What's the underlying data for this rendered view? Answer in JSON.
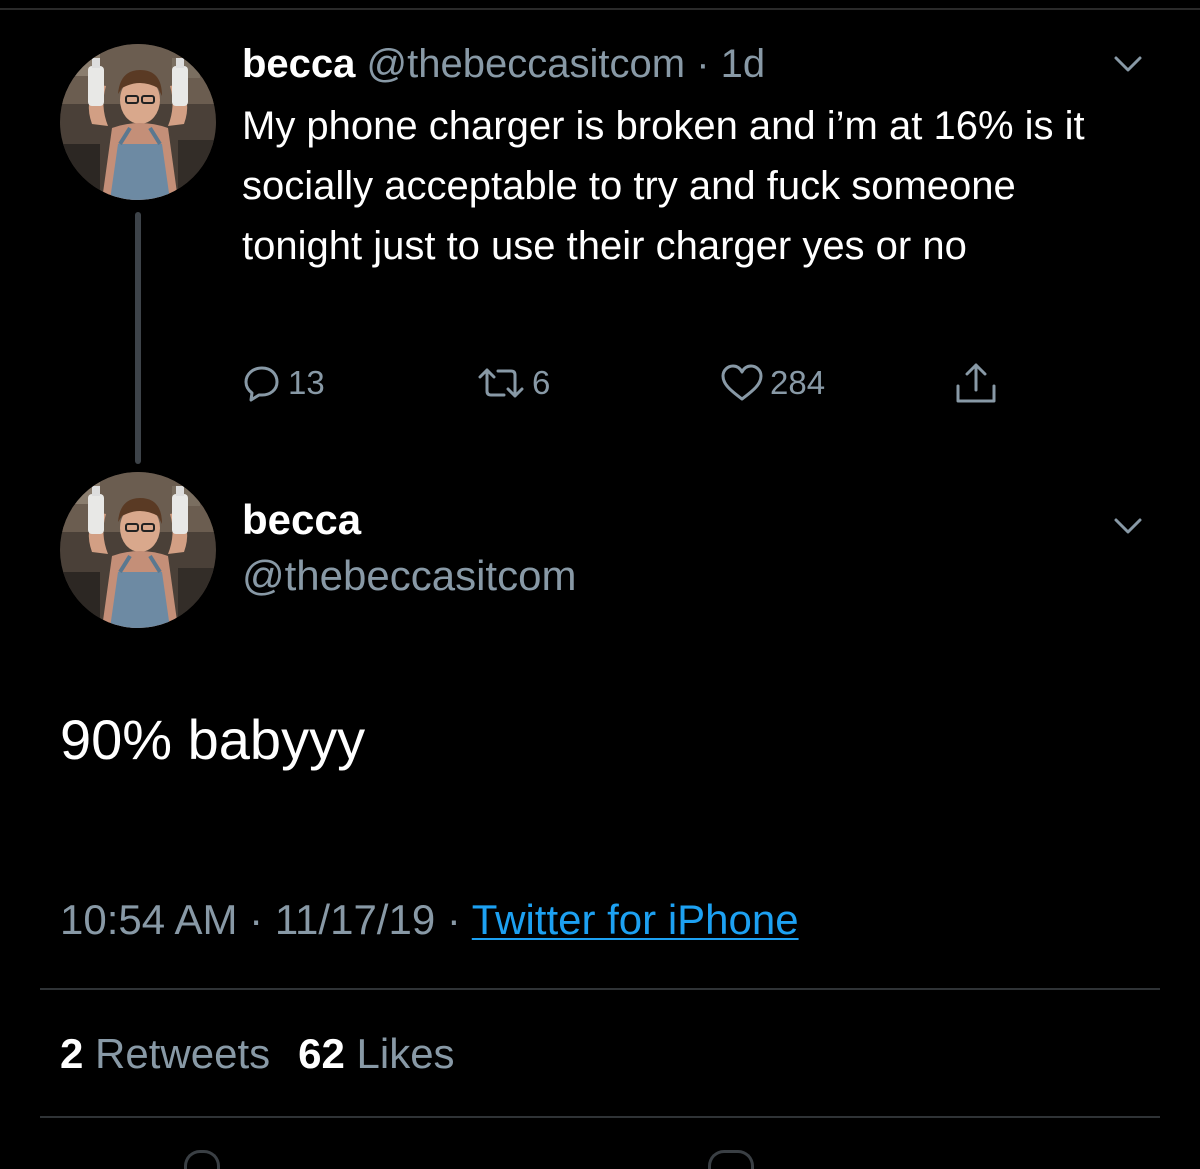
{
  "parent_tweet": {
    "display_name": "becca",
    "handle": "@thebeccasitcom",
    "separator": "·",
    "age": "1d",
    "text": "My phone charger is broken and i’m at 16% is it socially acceptable to try and fuck someone tonight just to use their charger yes or no",
    "replies": "13",
    "retweets": "6",
    "likes": "284"
  },
  "focused_tweet": {
    "display_name": "becca",
    "handle": "@thebeccasitcom",
    "text": "90% babyyy",
    "time": "10:54 AM",
    "date": "11/17/19",
    "separator": "·",
    "source": "Twitter for iPhone",
    "retweet_count": "2",
    "retweet_label": "Retweets",
    "like_count": "62",
    "like_label": "Likes"
  },
  "icons": {
    "chevron": "chevron-down-icon",
    "reply": "reply-icon",
    "retweet": "retweet-icon",
    "like": "heart-icon",
    "share": "share-icon"
  },
  "colors": {
    "background": "#000000",
    "text": "#ffffff",
    "muted": "#8899a6",
    "link": "#1da1f2",
    "divider": "#2f3336",
    "thread_line": "#3d4349"
  }
}
